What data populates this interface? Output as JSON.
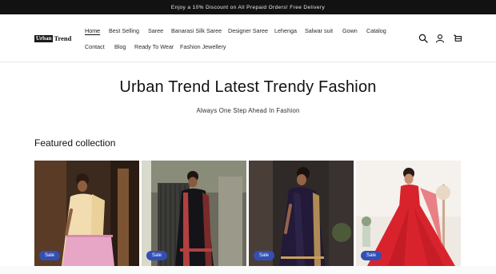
{
  "announcement": "Enjoy a 10% Discount on All Prepaid Orders! Free Delivery",
  "brand": {
    "logo_mark": "Urban",
    "logo_text": "Trend"
  },
  "nav": {
    "row1": [
      "Home",
      "Best Selling",
      "Saree",
      "Banarasi Silk Saree",
      "Designer Saree",
      "Lehenga",
      "Salwar suit",
      "Gown",
      "Catalog"
    ],
    "row2": [
      "Contact",
      "Blog",
      "Ready To Wear",
      "Fashion Jewellery"
    ],
    "active": "Home"
  },
  "header_icons": [
    "search-icon",
    "account-icon",
    "cart-icon"
  ],
  "hero": {
    "title": "Urban Trend Latest Trendy Fashion",
    "subtitle": "Always One Step Ahead In Fashion"
  },
  "featured": {
    "heading": "Featured collection",
    "products": [
      {
        "badge": "Sale",
        "palette": {
          "bg": "#3d2a1e",
          "garment": "#f1ddb0",
          "accent": "#e7a6c6"
        }
      },
      {
        "badge": "Sale",
        "palette": {
          "bg": "#6b6a5c",
          "garment": "#141418",
          "accent": "#b34040"
        }
      },
      {
        "badge": "Sale",
        "palette": {
          "bg": "#2f2a28",
          "garment": "#221a38",
          "accent": "#c9a05a"
        }
      },
      {
        "badge": "Sale",
        "palette": {
          "bg": "#efe9e3",
          "garment": "#d8232d",
          "accent": "#b51822"
        }
      }
    ]
  },
  "colors": {
    "announcement_bg": "#121212",
    "badge_bg": "#334fb4",
    "text": "#121212"
  }
}
